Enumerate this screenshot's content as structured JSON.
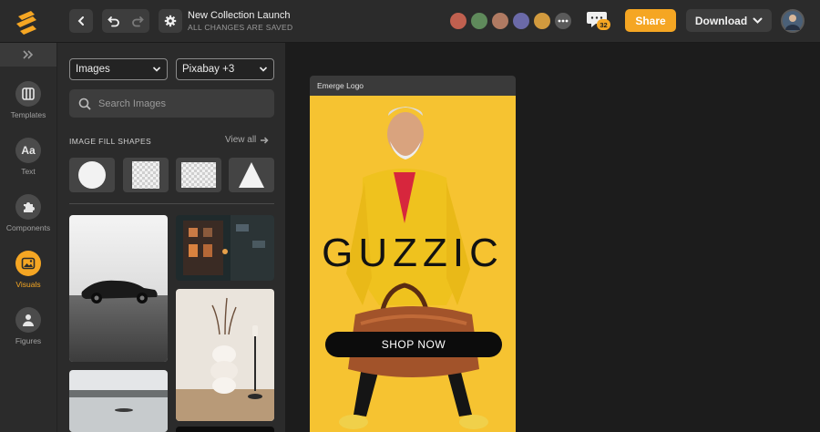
{
  "header": {
    "doc_title": "New Collection Launch",
    "doc_status": "ALL CHANGES ARE SAVED",
    "chat_count": "32",
    "share_label": "Share",
    "download_label": "Download",
    "collaborators": [
      {
        "name": "collaborator-1",
        "color": "#c0604f"
      },
      {
        "name": "collaborator-2",
        "color": "#5f8a5b"
      },
      {
        "name": "collaborator-3",
        "color": "#b07a62"
      },
      {
        "name": "collaborator-4",
        "color": "#6b6aa8"
      },
      {
        "name": "collaborator-5",
        "color": "#d19a3e"
      }
    ],
    "more_icon": "more-icon"
  },
  "sidebar": {
    "items": [
      {
        "label": "Templates",
        "icon": "templates-icon"
      },
      {
        "label": "Text",
        "icon": "text-icon"
      },
      {
        "label": "Components",
        "icon": "components-icon"
      },
      {
        "label": "Visuals",
        "icon": "visuals-icon",
        "active": true
      },
      {
        "label": "Figures",
        "icon": "figures-icon"
      }
    ],
    "text_icon_glyph": "Aa"
  },
  "panel": {
    "type_select": "Images",
    "source_select": "Pixabay +3",
    "search_placeholder": "Search Images",
    "section_title": "IMAGE FILL SHAPES",
    "view_all": "View all",
    "shapes": [
      "circle",
      "square",
      "rectangle",
      "triangle"
    ]
  },
  "canvas": {
    "artboard_label": "Emerge Logo",
    "brand_text": "GUZZIC",
    "cta_label": "SHOP NOW"
  },
  "colors": {
    "accent": "#f5a623",
    "artboard_bg": "#f6c331",
    "topbar": "#2b2b2b",
    "canvas_bg": "#1c1c1c"
  }
}
